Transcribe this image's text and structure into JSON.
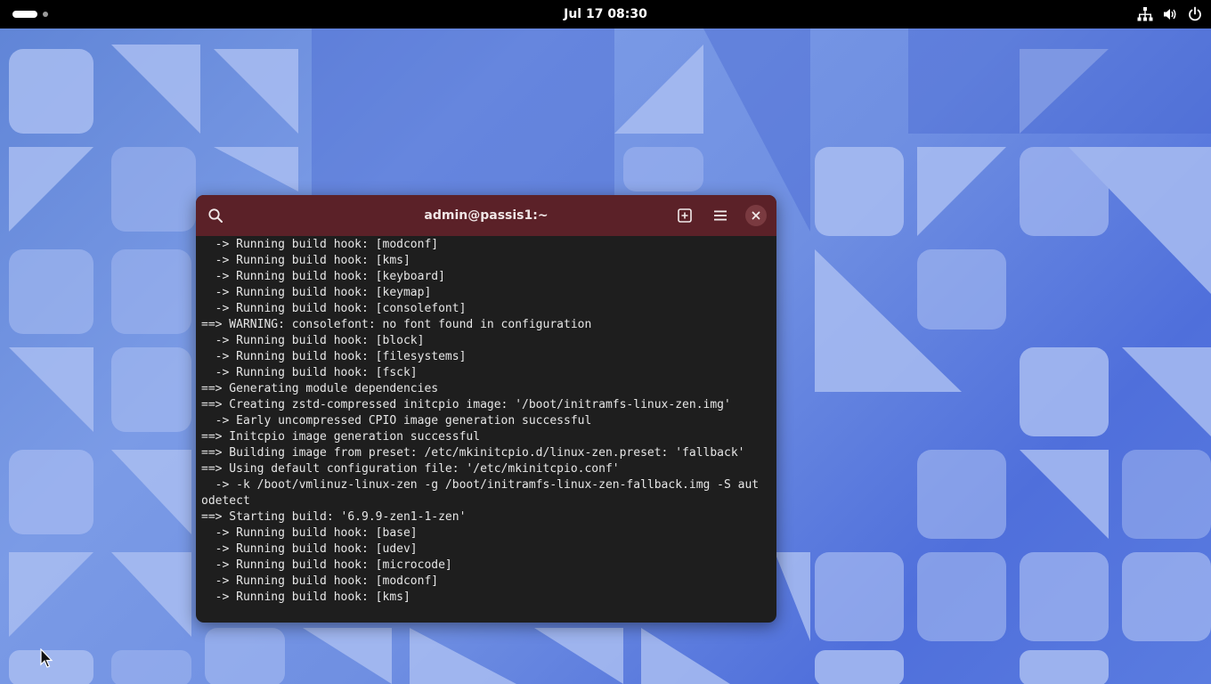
{
  "topbar": {
    "clock": "Jul 17  08:30",
    "icons": [
      "network-icon",
      "volume-icon",
      "power-icon"
    ]
  },
  "terminal": {
    "title": "admin@passis1:~",
    "header_color": "#5b2128",
    "buttons": [
      "search-icon",
      "new-tab-icon",
      "menu-icon",
      "close-icon"
    ],
    "lines": [
      "  -> Running build hook: [modconf]",
      "  -> Running build hook: [kms]",
      "  -> Running build hook: [keyboard]",
      "  -> Running build hook: [keymap]",
      "  -> Running build hook: [consolefont]",
      "==> WARNING: consolefont: no font found in configuration",
      "  -> Running build hook: [block]",
      "  -> Running build hook: [filesystems]",
      "  -> Running build hook: [fsck]",
      "==> Generating module dependencies",
      "==> Creating zstd-compressed initcpio image: '/boot/initramfs-linux-zen.img'",
      "  -> Early uncompressed CPIO image generation successful",
      "==> Initcpio image generation successful",
      "==> Building image from preset: /etc/mkinitcpio.d/linux-zen.preset: 'fallback'",
      "==> Using default configuration file: '/etc/mkinitcpio.conf'",
      "  -> -k /boot/vmlinuz-linux-zen -g /boot/initramfs-linux-zen-fallback.img -S aut",
      "odetect",
      "==> Starting build: '6.9.9-zen1-1-zen'",
      "  -> Running build hook: [base]",
      "  -> Running build hook: [udev]",
      "  -> Running build hook: [microcode]",
      "  -> Running build hook: [modconf]",
      "  -> Running build hook: [kms]"
    ]
  },
  "desktop": {
    "background_color": "#6f8fe2"
  }
}
